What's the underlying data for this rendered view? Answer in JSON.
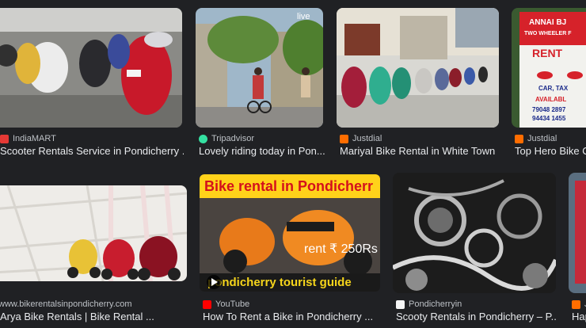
{
  "results": [
    {
      "source": "IndiaMART",
      "title": "Scooter Rentals Service in Pondicherry ...",
      "favicon_color": "#e53935"
    },
    {
      "source": "Tripadvisor",
      "title": "Lovely riding today in Pon...",
      "favicon_color": "#34e0a1",
      "image_text": "live"
    },
    {
      "source": "Justdial",
      "title": "Mariyal Bike Rental in White Town ...",
      "favicon_color": "#ff6d00"
    },
    {
      "source": "Justdial",
      "title": "Top Hero Bike O",
      "favicon_color": "#ff6d00",
      "image_text": {
        "line1": "ANNAI BJ",
        "line2": "TWO WHEELER F",
        "line3": "RENT",
        "line4": "CAR, TAX",
        "line5": "AVAILABL",
        "line6": "79048 2897",
        "line7": "94434 1455"
      }
    },
    {
      "source": "www.bikerentalsinpondicherry.com",
      "title": "Arya Bike Rentals | Bike Rental ...",
      "favicon_color": ""
    },
    {
      "source": "YouTube",
      "title": "How To Rent a Bike in Pondicherry ...",
      "favicon_color": "#ff0000",
      "image_text": {
        "top": "Bike rental in Pondicherr",
        "price": "rent ₹ 250Rs",
        "bottom": "pondicherry tourist guide"
      }
    },
    {
      "source": "Pondicherryin",
      "title": "Scooty Rentals in Pondicherry – P...",
      "favicon_color": "#f5f5f5"
    },
    {
      "source": "Ju",
      "title": "Hap",
      "favicon_color": "#ff6d00"
    }
  ]
}
